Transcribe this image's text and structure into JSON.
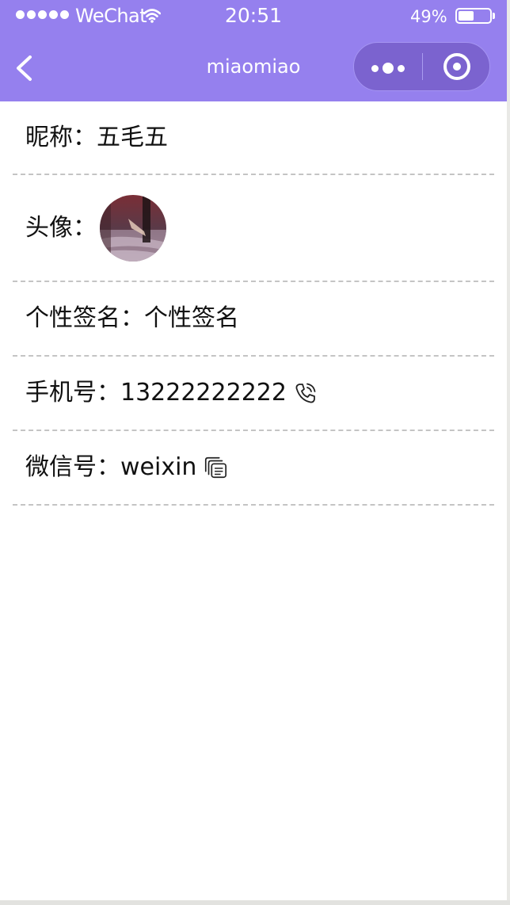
{
  "status_bar": {
    "carrier": "WeChat",
    "time": "20:51",
    "battery_percent": "49%",
    "battery_level": 0.49,
    "signal_icon": "signal-dots-icon",
    "wifi_icon": "wifi-icon"
  },
  "nav": {
    "title": "miaomiao",
    "back_icon": "chevron-left-icon",
    "more_icon": "more-dots-icon",
    "close_icon": "target-circle-icon",
    "background_color": "#9580ee",
    "capsule_color": "#7b63cf"
  },
  "profile": {
    "nickname": {
      "label": "昵称：",
      "value": "五毛五"
    },
    "avatar": {
      "label": "头像："
    },
    "signature": {
      "label": "个性签名：",
      "value": "个性签名"
    },
    "phone": {
      "label": "手机号：",
      "value": "13222222222",
      "icon": "phone-call-icon"
    },
    "wechat": {
      "label": "微信号：",
      "value": "weixin",
      "icon": "copy-icon"
    }
  }
}
